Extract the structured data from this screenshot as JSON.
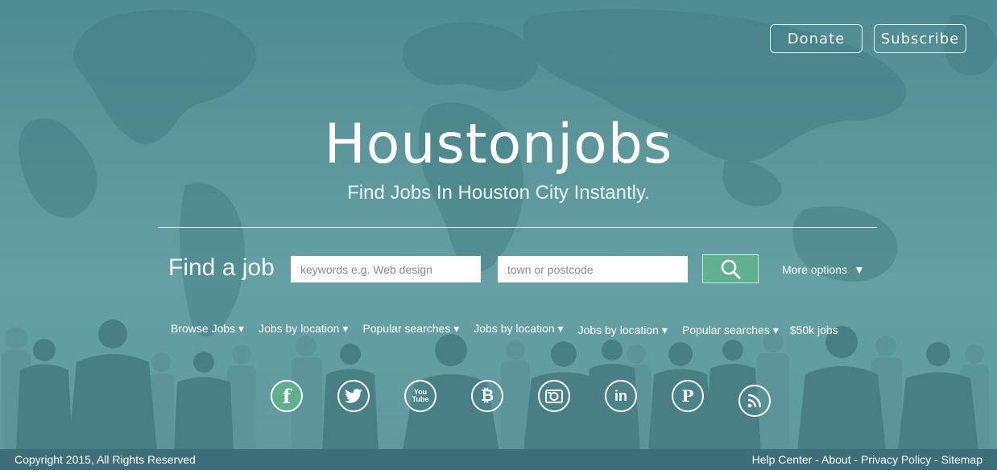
{
  "header": {
    "donate_label": "Donate",
    "subscribe_label": "Subscribe"
  },
  "hero": {
    "logo": "Houstonjobs",
    "tagline": "Find Jobs In Houston City Instantly."
  },
  "search": {
    "heading": "Find a job",
    "keywords_placeholder": "keywords e.g. Web design",
    "location_placeholder": "town or postcode",
    "search_icon": "search-icon",
    "more_options": "More options",
    "more_arrow": "▼"
  },
  "nav": [
    {
      "label": "Browse Jobs ▾"
    },
    {
      "label": "Jobs by location ▾"
    },
    {
      "label": "Popular searches ▾"
    },
    {
      "label": "Jobs by location ▾"
    },
    {
      "label": "Jobs by location ▾"
    },
    {
      "label": "Popular searches ▾"
    },
    {
      "label": "$50k jobs"
    }
  ],
  "social": [
    {
      "name": "facebook-icon",
      "glyph": "f",
      "color": "#5fb08d"
    },
    {
      "name": "twitter-icon",
      "glyph": "",
      "color": "#4f8c91"
    },
    {
      "name": "youtube-icon",
      "glyph": "You Tube",
      "color": "#4f8c91"
    },
    {
      "name": "bitcoin-icon",
      "glyph": "₿",
      "color": "#4f8c91"
    },
    {
      "name": "instagram-icon",
      "glyph": "",
      "color": "#4f8c91"
    },
    {
      "name": "linkedin-icon",
      "glyph": "in",
      "color": "#4f8c91"
    },
    {
      "name": "pinterest-icon",
      "glyph": "P",
      "color": "#4f8c91"
    },
    {
      "name": "rss-icon",
      "glyph": "",
      "color": "#4f8c91"
    }
  ],
  "footer": {
    "copyright": "Copyright 2015, All Rights Reserved",
    "links": [
      "Help Center",
      "About",
      "Privacy Policy",
      "Sitemap"
    ],
    "separator": " - "
  },
  "colors": {
    "background": "#5e999d",
    "footer": "#3c6f77",
    "search_button": "#5fb08d"
  }
}
